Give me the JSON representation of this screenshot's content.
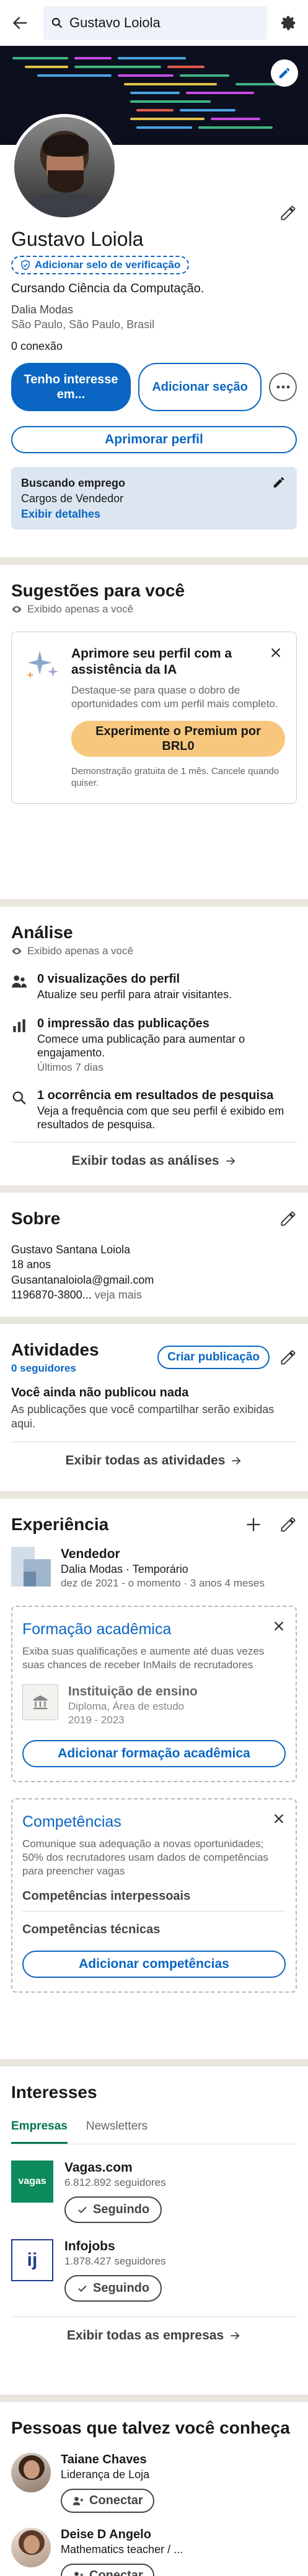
{
  "search": {
    "query": "Gustavo Loiola"
  },
  "profile": {
    "name": "Gustavo Loiola",
    "verify_label": "Adicionar selo de verificação",
    "headline": "Cursando Ciência da Computação.",
    "company": "Dalia Modas",
    "location": "São Paulo, São Paulo, Brasil",
    "connections": "0 conexão",
    "primary_button": "Tenho interesse em...",
    "secondary_button": "Adicionar seção",
    "enhance_button": "Aprimorar perfil",
    "open_to_work": {
      "title": "Buscando emprego",
      "subtitle": "Cargos de Vendedor",
      "link": "Exibir detalhes"
    }
  },
  "suggestions": {
    "title": "Sugestões para você",
    "private_note": "Exibido apenas a você",
    "card_title": "Aprimore seu perfil com a assistência da IA",
    "card_desc": "Destaque-se para quase o dobro de oportunidades com um perfil mais completo.",
    "premium_button": "Experimente o Premium por BRL0",
    "trial_note": "Demonstração gratuita de 1 mês. Cancele quando quiser."
  },
  "analytics": {
    "title": "Análise",
    "private_note": "Exibido apenas a você",
    "items": [
      {
        "title": "0 visualizações do perfil",
        "desc": "Atualize seu perfil para atrair visitantes.",
        "meta": ""
      },
      {
        "title": "0 impressão das publicações",
        "desc": "Comece uma publicação para aumentar o engajamento.",
        "meta": "Últimos 7 dias"
      },
      {
        "title": "1 ocorrência em resultados de pesquisa",
        "desc": "Veja a frequência com que seu perfil é exibido em resultados de pesquisa.",
        "meta": ""
      }
    ],
    "show_all": "Exibir todas as análises"
  },
  "about": {
    "title": "Sobre",
    "lines": [
      "Gustavo Santana Loiola",
      "18 anos",
      "Gusantanaloiola@gmail.com"
    ],
    "last_line": "1196870-3800...",
    "see_more": "veja mais"
  },
  "activity": {
    "title": "Atividades",
    "followers": "0 seguidores",
    "create_button": "Criar publicação",
    "empty_title": "Você ainda não publicou nada",
    "empty_desc": "As publicações que você compartilhar serão exibidas aqui.",
    "show_all": "Exibir todas as atividades"
  },
  "experience": {
    "title": "Experiência",
    "items": [
      {
        "role": "Vendedor",
        "company": "Dalia Modas · Temporário",
        "dates": "dez de 2021 - o momento · 3 anos 4 meses"
      }
    ]
  },
  "education": {
    "title": "Formação acadêmica",
    "desc": "Exiba suas qualificações e aumente até duas vezes suas chances de receber InMails de recrutadores",
    "placeholder_name": "Instituição de ensino",
    "placeholder_degree": "Diploma, Área de estudo",
    "placeholder_years": "2019 - 2023",
    "button": "Adicionar formação acadêmica"
  },
  "skills": {
    "title": "Competências",
    "desc": "Comunique sua adequação a novas oportunidades; 50% dos recrutadores usam dados de competências para preencher vagas",
    "items": [
      "Competências interpessoais",
      "Competências técnicas"
    ],
    "button": "Adicionar competências"
  },
  "interests": {
    "title": "Interesses",
    "tabs": [
      "Empresas",
      "Newsletters"
    ],
    "items": [
      {
        "name": "Vagas.com",
        "followers": "6.812.892 seguidores",
        "button": "Seguindo",
        "logo_text": "vagas",
        "logo_bg": "#0c8a5a"
      },
      {
        "name": "Infojobs",
        "followers": "1.878.427 seguidores",
        "button": "Seguindo",
        "logo_text": "ij",
        "logo_bg": "#1d3c8e"
      }
    ],
    "show_all": "Exibir todas as empresas"
  },
  "people": {
    "title": "Pessoas que talvez você conheça",
    "items": [
      {
        "name": "Taiane Chaves",
        "headline": "Liderança de Loja",
        "button": "Conectar"
      },
      {
        "name": "Deise D Angelo",
        "headline": "Mathematics teacher / ...",
        "button": "Conectar"
      }
    ]
  },
  "colors": {
    "primary": "#0a66c2",
    "premium": "#f8c77e",
    "green_tab": "#01754f"
  }
}
